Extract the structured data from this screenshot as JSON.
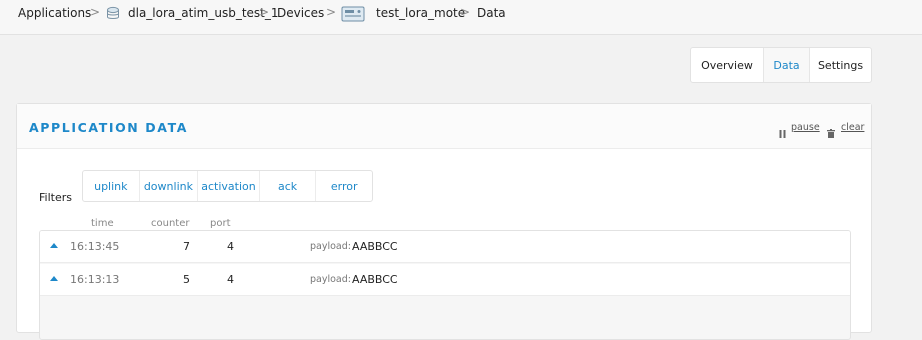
{
  "breadcrumb": {
    "applications": "Applications",
    "application": "dla_lora_atim_usb_test_1",
    "devices": "Devices",
    "device": "test_lora_mote",
    "data": "Data",
    "separator": ">"
  },
  "icons": {
    "application": "layers-icon",
    "device": "device-board-icon",
    "pause": "pause-icon",
    "clear": "trash-icon",
    "expand": "triangle-up-icon"
  },
  "tabs": [
    {
      "label": "Overview",
      "active": false
    },
    {
      "label": "Data",
      "active": true
    },
    {
      "label": "Settings",
      "active": false
    }
  ],
  "panel": {
    "title": "APPLICATION DATA",
    "pause_label": "pause",
    "clear_label": "clear"
  },
  "filters": {
    "label": "Filters",
    "items": [
      "uplink",
      "downlink",
      "activation",
      "ack",
      "error"
    ]
  },
  "columns": {
    "time": "time",
    "counter": "counter",
    "port": "port"
  },
  "rows": [
    {
      "time": "16:13:45",
      "counter": "7",
      "port": "4",
      "payload_label": "payload:",
      "payload": "AABBCC"
    },
    {
      "time": "16:13:13",
      "counter": "5",
      "port": "4",
      "payload_label": "payload:",
      "payload": "AABBCC"
    }
  ],
  "colors": {
    "accent": "#1e88c9",
    "background": "#f2f2f2",
    "panel": "#ffffff"
  }
}
